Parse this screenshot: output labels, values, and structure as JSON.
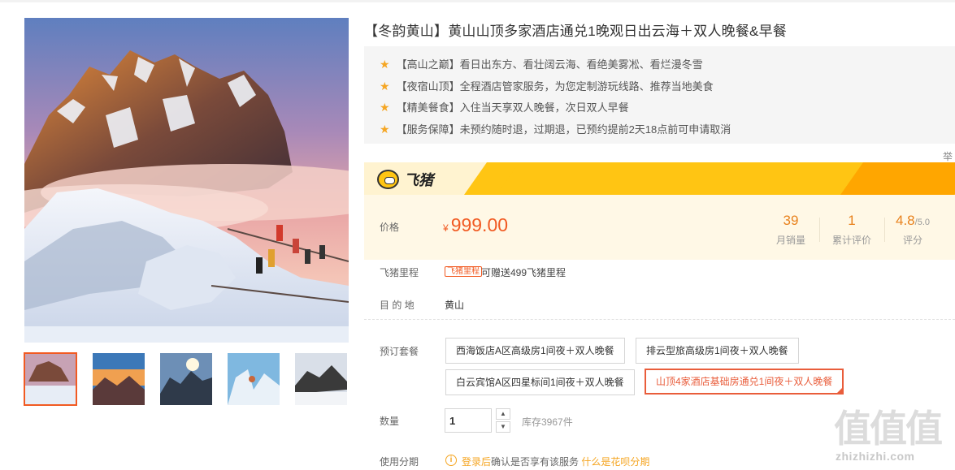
{
  "product": {
    "title": "【冬韵黄山】黄山山顶多家酒店通兑1晚观日出云海＋双人晚餐&早餐",
    "features": [
      "【高山之巅】看日出东方、看壮阔云海、看绝美雾凇、看烂漫冬雪",
      "【夜宿山顶】全程酒店管家服务，为您定制游玩线路、推荐当地美食",
      "【精美餐食】入住当天享双人晚餐，次日双人早餐",
      "【服务保障】未预约随时退，过期退，已预约提前2天18点前可申请取消"
    ],
    "side_char": "举"
  },
  "brand": {
    "name": "飞猪",
    "logo_icon": "fliggy-pig-icon"
  },
  "price": {
    "label": "价格",
    "currency": "¥",
    "value": "999.00",
    "monthly_sales": {
      "value": "39",
      "label": "月销量"
    },
    "reviews": {
      "value": "1",
      "label": "累计评价"
    },
    "rating": {
      "value": "4.8",
      "max": "/5.0",
      "label": "评分"
    }
  },
  "mileage": {
    "label": "飞猪里程",
    "badge": "飞猪里程",
    "text": "可赠送499飞猪里程"
  },
  "destination": {
    "label": "目 的 地",
    "value": "黄山"
  },
  "packages": {
    "label": "预订套餐",
    "options": [
      "西海饭店A区高级房1间夜＋双人晚餐",
      "排云型旅高级房1间夜＋双人晚餐",
      "白云宾馆A区四星标间1间夜＋双人晚餐",
      "山顶4家酒店基础房通兑1间夜＋双人晚餐"
    ],
    "selected_index": 3
  },
  "quantity": {
    "label": "数量",
    "value": "1",
    "stock": "库存3967件"
  },
  "installment": {
    "label": "使用分期",
    "login_link": "登录后",
    "text": "确认是否享有该服务",
    "help_link": "什么是花呗分期"
  },
  "watermark": {
    "chars": "值值值",
    "url": "zhizhizhi.com"
  },
  "colors": {
    "accent": "#f15a22",
    "brand_yellow": "#ffc513",
    "star": "#f5a623",
    "stat": "#e8811c"
  }
}
